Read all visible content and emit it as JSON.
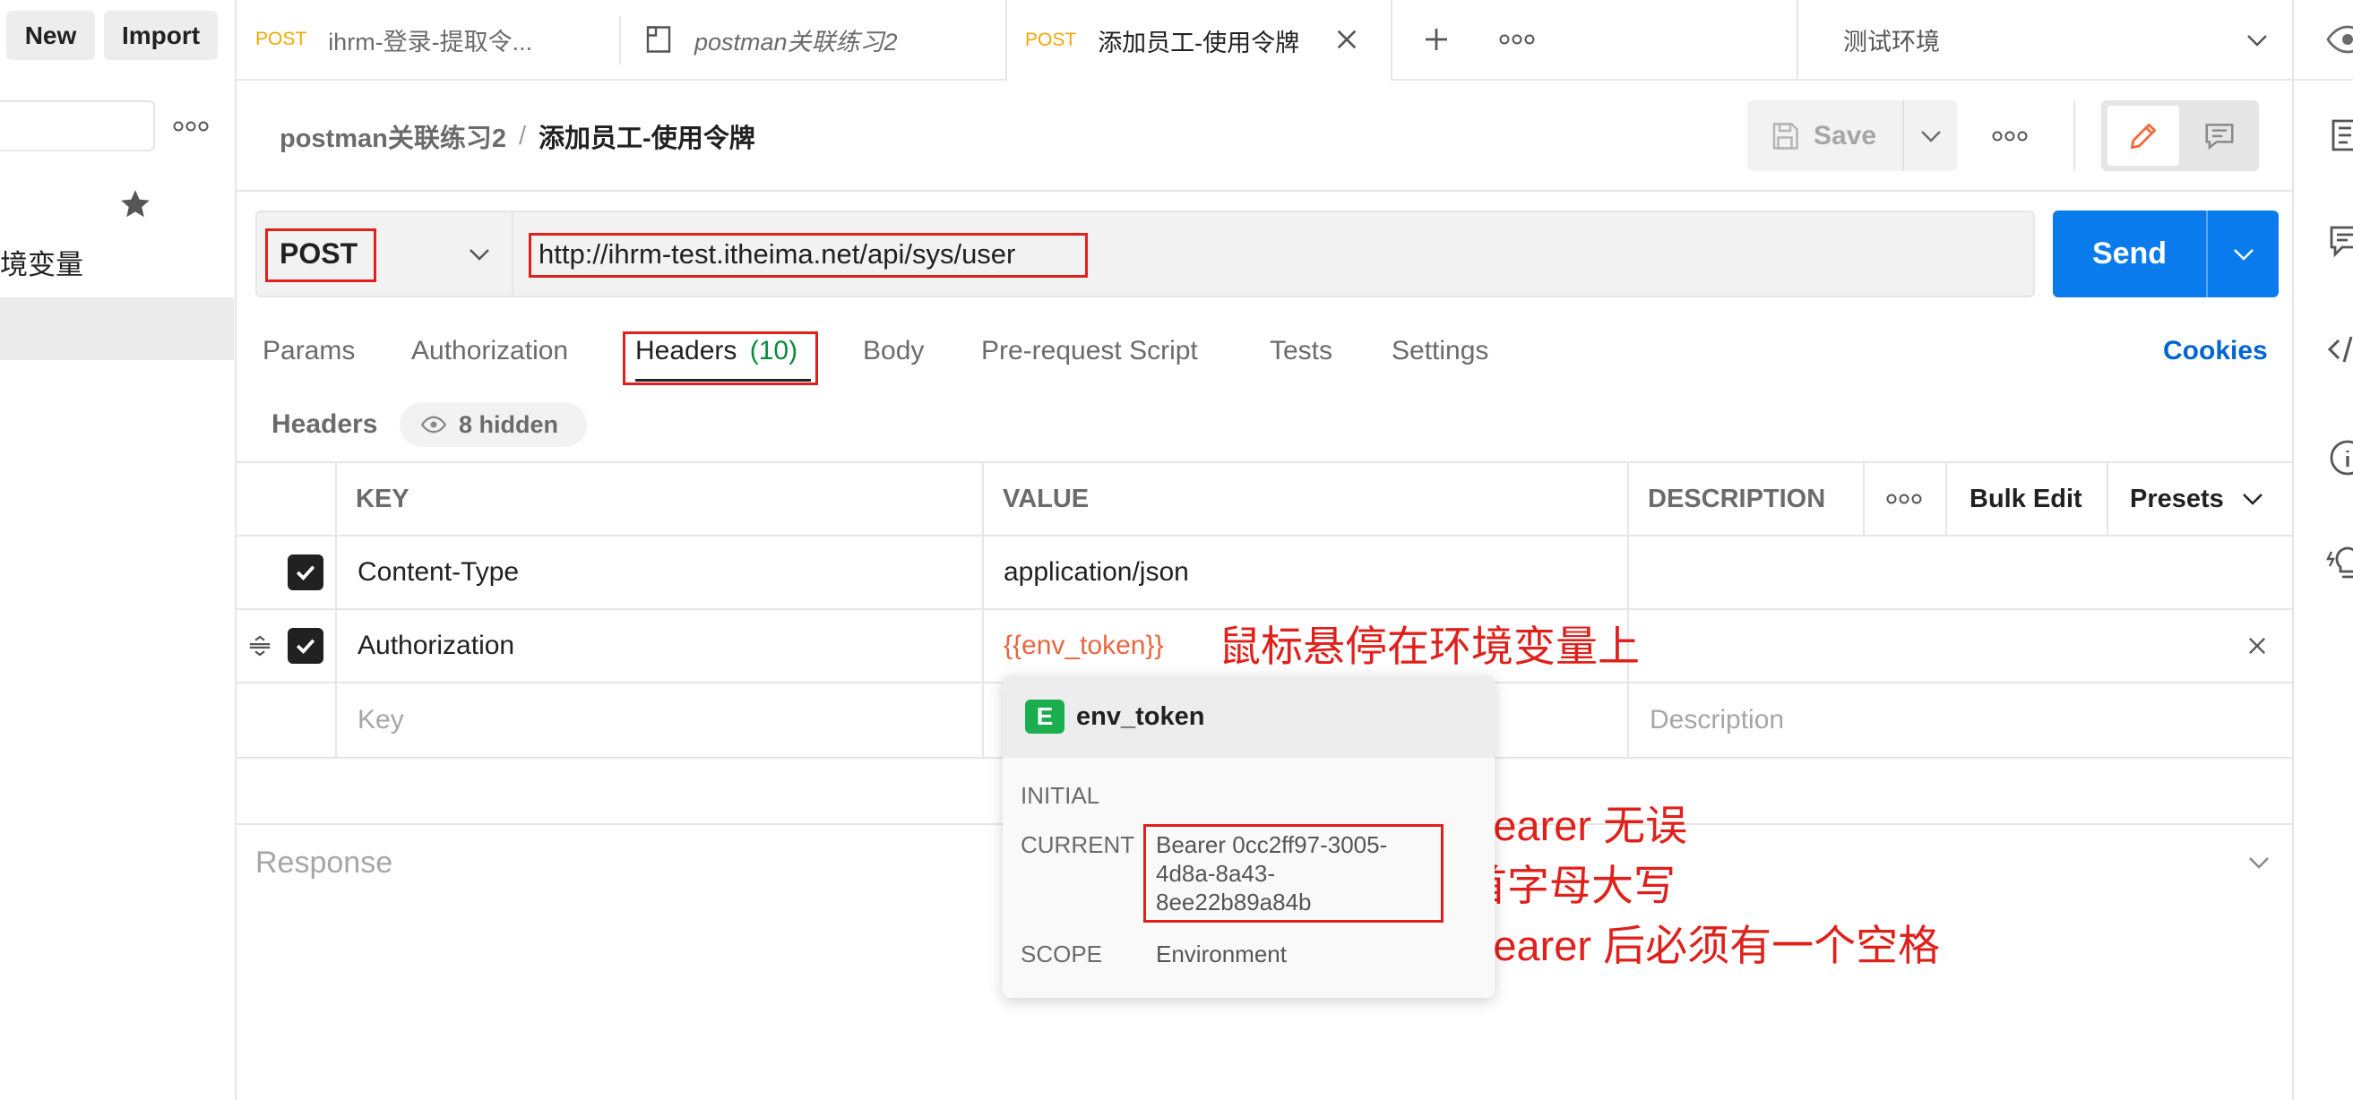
{
  "top_bar": {
    "new_label": "New",
    "import_label": "Import"
  },
  "sidebar": {
    "item_label": "境变量"
  },
  "tabs": [
    {
      "method": "POST",
      "title": "ihrm-登录-提取令..."
    },
    {
      "title": "postman关联练习2"
    },
    {
      "method": "POST",
      "title": "添加员工-使用令牌"
    }
  ],
  "environment": {
    "selected": "测试环境"
  },
  "breadcrumb": {
    "collection": "postman关联练习2",
    "separator": "/",
    "request": "添加员工-使用令牌"
  },
  "toolbar": {
    "save_label": "Save"
  },
  "request": {
    "method": "POST",
    "url": "http://ihrm-test.itheima.net/api/sys/user",
    "send_label": "Send"
  },
  "request_tabs": [
    {
      "label": "Params"
    },
    {
      "label": "Authorization"
    },
    {
      "label": "Headers",
      "count": "(10)"
    },
    {
      "label": "Body"
    },
    {
      "label": "Pre-request Script"
    },
    {
      "label": "Tests"
    },
    {
      "label": "Settings"
    }
  ],
  "cookies_label": "Cookies",
  "headers_section": {
    "title": "Headers",
    "hidden_label": "8 hidden"
  },
  "headers_table": {
    "columns": {
      "key": "KEY",
      "value": "VALUE",
      "description": "DESCRIPTION",
      "bulk_edit": "Bulk Edit",
      "presets": "Presets"
    },
    "rows": [
      {
        "enabled": true,
        "key": "Content-Type",
        "value": "application/json"
      },
      {
        "enabled": true,
        "key": "Authorization",
        "value": "{{env_token}}"
      }
    ],
    "placeholder": {
      "key": "Key",
      "description": "Description"
    }
  },
  "response": {
    "label": "Response"
  },
  "variable_popover": {
    "badge": "E",
    "name": "env_token",
    "initial_label": "INITIAL",
    "initial_value": "",
    "current_label": "CURRENT",
    "current_value": "Bearer 0cc2ff97-3005-4d8a-8a43-8ee22b89a84b",
    "scope_label": "SCOPE",
    "scope_value": "Environment"
  },
  "annotations": {
    "hover_note": "鼠标悬停在环境变量上",
    "bearer_notes": [
      "Bearer 无误",
      "首字母大写",
      "Bearer 后必须有一个空格"
    ]
  },
  "colors": {
    "accent_blue": "#097bed",
    "annotation_red": "#e0201b",
    "variable_orange": "#e9663f",
    "env_badge_green": "#1aae4f",
    "method_post": "#f0a800",
    "count_green": "#0a8a3d",
    "link_blue": "#0265d2"
  }
}
